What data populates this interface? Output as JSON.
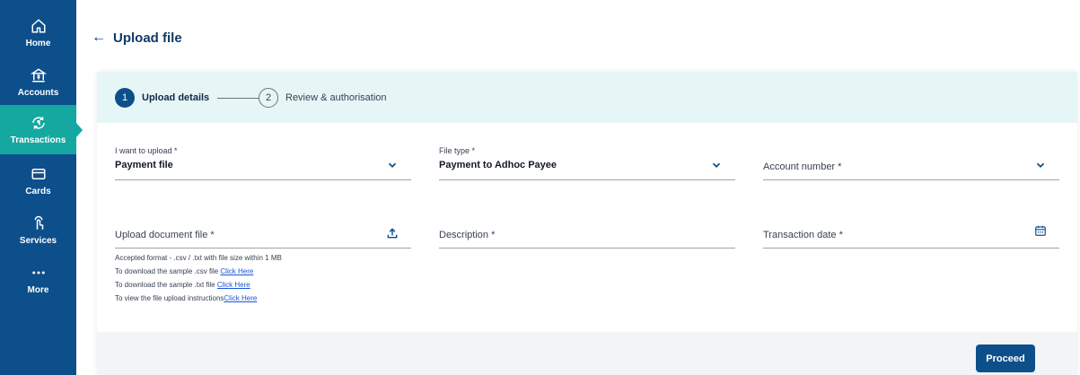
{
  "sidebar": {
    "items": [
      {
        "label": "Home",
        "icon": "home-icon"
      },
      {
        "label": "Accounts",
        "icon": "bank-icon"
      },
      {
        "label": "Transactions",
        "icon": "transfer-icon"
      },
      {
        "label": "Cards",
        "icon": "card-icon"
      },
      {
        "label": "Services",
        "icon": "tap-icon"
      },
      {
        "label": "More",
        "icon": "more-icon"
      }
    ]
  },
  "header": {
    "back": "←",
    "title": "Upload file"
  },
  "stepper": {
    "steps": [
      {
        "number": "1",
        "label": "Upload details"
      },
      {
        "number": "2",
        "label": "Review & authorisation"
      }
    ]
  },
  "form": {
    "upload_type": {
      "label": "I want to upload *",
      "value": "Payment file"
    },
    "file_type": {
      "label": "File type *",
      "value": "Payment to Adhoc Payee"
    },
    "account_number": {
      "placeholder": "Account number *"
    },
    "upload_document": {
      "placeholder": "Upload document file *"
    },
    "description": {
      "placeholder": "Description *"
    },
    "transaction_date": {
      "placeholder": "Transaction date *"
    }
  },
  "hints": {
    "format": "Accepted format - .csv / .txt with file size within 1 MB",
    "csv_text": "To download the sample .csv file ",
    "csv_link": "Click Here",
    "txt_text": "To download the sample .txt file ",
    "txt_link": "Click Here",
    "instructions_text": "To view the file upload instructions",
    "instructions_link": "Click Here"
  },
  "footer": {
    "proceed": "Proceed"
  },
  "colors": {
    "sidebar": "#0d4f8b",
    "active_nav": "#14a8a0",
    "stepper_bg": "#e6f6f7",
    "primary": "#0d4f8b",
    "link": "#1a56db"
  }
}
